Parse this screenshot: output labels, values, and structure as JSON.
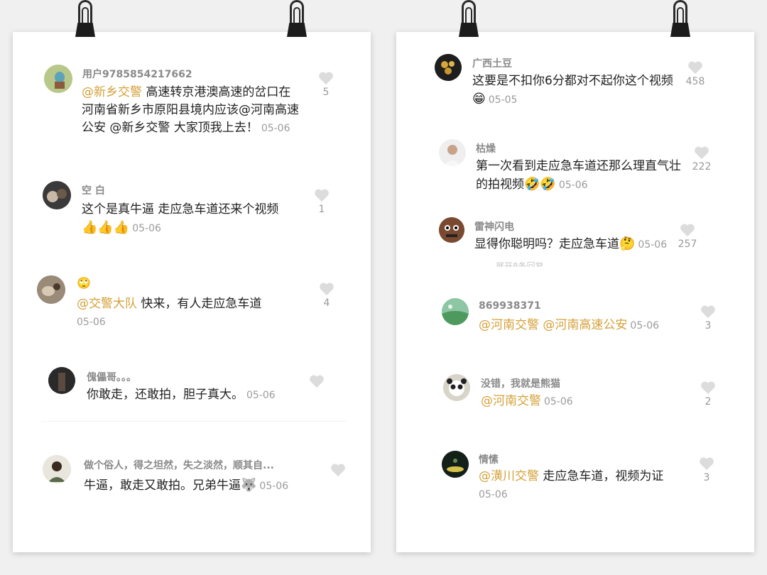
{
  "left_card": {
    "comments": [
      {
        "user": "用户9785854217662",
        "text_parts": [
          {
            "mention": "@新乡交警"
          },
          {
            "text": " 高速转京港澳高速的岔口在河南省新乡市原阳县境内应该@河南高速公安 @新乡交警 大家顶我上去！"
          }
        ],
        "date": "05-06",
        "likes": "5"
      },
      {
        "user": "空 白",
        "text": "这个是真牛逼 走应急车道还来个视频",
        "emoji": "👍👍👍",
        "date": "05-06",
        "likes": "1"
      },
      {
        "user_emoji": "🙄",
        "mention": "@交警大队",
        "text": " 快来，有人走应急车道",
        "date": "05-06",
        "likes": "4"
      },
      {
        "user": "傀儡哥。。。",
        "text": "你敢走，还敢拍，胆子真大。",
        "date": "05-06",
        "likes": ""
      },
      {
        "user": "做个俗人，得之坦然，失之淡然，顺其自...",
        "text": "牛逼，敢走又敢拍。兄弟牛逼",
        "emoji": "🐺",
        "date": "05-06",
        "likes": ""
      }
    ]
  },
  "right_card": {
    "comments": [
      {
        "user": "广西土豆",
        "text": "这要是不扣你6分都对不起你这个视频",
        "emoji": "😁",
        "date": "05-05",
        "likes": "458"
      },
      {
        "user": "枯燥",
        "text": "第一次看到走应急车道还那么理直气壮的拍视频",
        "emoji": "🤣🤣",
        "date": "05-06",
        "likes": "222"
      },
      {
        "user": "雷神闪电",
        "text": "显得你聪明吗？走应急车道",
        "emoji": "🤔",
        "date": "05-06",
        "likes": "257",
        "expand": "展开8条回复 ⌄"
      },
      {
        "user": "869938371",
        "mention": "@河南交警 @河南高速公安",
        "date": "05-06",
        "likes": "3"
      },
      {
        "user": "没错，我就是熊猫",
        "mention": "@河南交警",
        "date": "05-06",
        "likes": "2"
      },
      {
        "user": "情愫",
        "mention": "@潢川交警",
        "text": " 走应急车道，视频为证",
        "date": "05-06",
        "likes": "3"
      }
    ]
  },
  "colors": {
    "mention": "#d4a13a",
    "username": "#8a8a8a",
    "text": "#222222",
    "date": "#9b9b9b",
    "heart": "#dcdcdc"
  }
}
